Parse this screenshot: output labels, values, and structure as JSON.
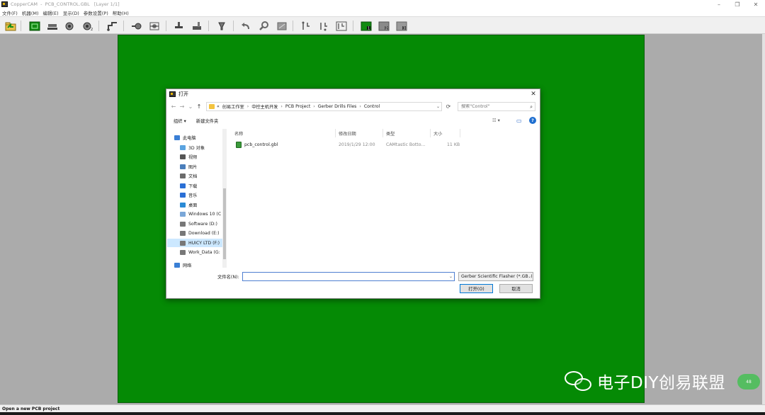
{
  "window": {
    "app_name": "CopperCAM",
    "title": "CopperCAM  -  PCB_CONTROL.GBL   [Layer 1/1]",
    "controls": [
      "–",
      "❐",
      "✕"
    ]
  },
  "menu": [
    "文件(F)",
    "机器(M)",
    "编辑(E)",
    "显示(D)",
    "参数设置(P)",
    "帮助(H)"
  ],
  "toolbar": {
    "icons": [
      "open-project",
      "layer-view",
      "pcb-tool",
      "drill-1",
      "drill-2",
      "contour",
      "pad",
      "align-center",
      "trace",
      "cutter",
      "engrave",
      "undo",
      "zoom",
      "zoom-fit",
      "path-1",
      "path-2",
      "path-3",
      "layer-1",
      "layer-2",
      "layer-3"
    ]
  },
  "status": {
    "text": "Open a new PCB project"
  },
  "colors": {
    "board": "#058a05",
    "workspace": "#ababab",
    "accent": "#0078d7"
  },
  "dialog": {
    "title": "打开",
    "close": "✕",
    "nav": {
      "back": "←",
      "forward": "→",
      "recent": "⌄",
      "up": "↑",
      "refresh": "⟳"
    },
    "breadcrumb": [
      "«",
      "创易工作室",
      "中控主机开发",
      "PCB Project",
      "Gerber Drills Files",
      "Control"
    ],
    "search_placeholder": "搜索\"Control\"",
    "commands": {
      "organize": "组织 ▾",
      "new_folder": "新建文件夹",
      "view": "☷ ▾",
      "pane": "▭",
      "help": "?"
    },
    "nav_pane": [
      {
        "label": "此电脑",
        "icon": "pc-icon",
        "color": "#3a7fd5",
        "indent": 0
      },
      {
        "label": "3D 对象",
        "icon": "3d-objects-icon",
        "color": "#5aa3e0",
        "indent": 1
      },
      {
        "label": "视频",
        "icon": "video-icon",
        "color": "#555555",
        "indent": 1
      },
      {
        "label": "图片",
        "icon": "pictures-icon",
        "color": "#4a7ebb",
        "indent": 1
      },
      {
        "label": "文档",
        "icon": "documents-icon",
        "color": "#6b6b6b",
        "indent": 1
      },
      {
        "label": "下载",
        "icon": "downloads-icon",
        "color": "#2a6fd5",
        "indent": 1
      },
      {
        "label": "音乐",
        "icon": "music-icon",
        "color": "#2a6fd5",
        "indent": 1
      },
      {
        "label": "桌面",
        "icon": "desktop-icon",
        "color": "#2a8ad5",
        "indent": 1
      },
      {
        "label": "Windows 10 (C",
        "icon": "drive-c-icon",
        "color": "#7aa7d8",
        "indent": 1
      },
      {
        "label": "Software (D:)",
        "icon": "drive-icon",
        "color": "#777777",
        "indent": 1
      },
      {
        "label": "Download (E:)",
        "icon": "drive-icon",
        "color": "#777777",
        "indent": 1
      },
      {
        "label": "HUICY LTD (F:)",
        "icon": "drive-icon",
        "color": "#777777",
        "indent": 1,
        "selected": true
      },
      {
        "label": "Work_Data (G:",
        "icon": "drive-icon",
        "color": "#777777",
        "indent": 1
      },
      {
        "label": "网络",
        "icon": "network-icon",
        "color": "#3a7fd5",
        "indent": 0
      }
    ],
    "columns": [
      "名称",
      "修改日期",
      "类型",
      "大小"
    ],
    "files": [
      {
        "name": "pcb_control.gbl",
        "modified": "2019/1/29 12:00",
        "type": "CAMtastic Botto...",
        "size": "11 KB"
      }
    ],
    "filename_label": "文件名(N):",
    "filename_value": "",
    "filetype": "Gerber Scientific Flasher  (*.GBL)",
    "open_button": "打开(O)",
    "cancel_button": "取消"
  },
  "watermark": {
    "text": "电子DIY创易联盟",
    "badge": "48"
  }
}
